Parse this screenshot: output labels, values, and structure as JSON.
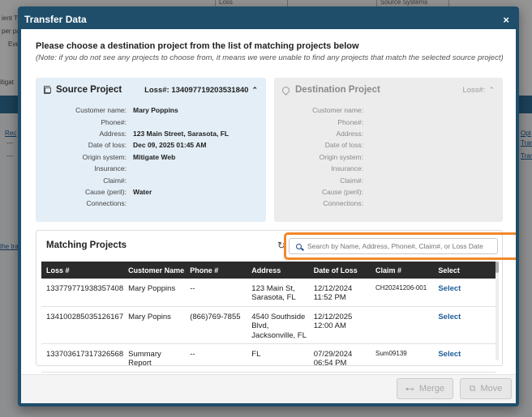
{
  "background": {
    "labels": [
      "ient Typ",
      "per pa",
      "Eve",
      "itigat",
      "Rec",
      "the trai",
      "Opt",
      "Tran",
      "Tran",
      "---",
      "---"
    ],
    "inputs": [
      "Loss",
      "Source Systems"
    ]
  },
  "modal": {
    "title": "Transfer Data",
    "close": "×",
    "heading": "Please choose a destination project from the list of matching projects below",
    "note": "(Note: if you do not see any projects to choose from, it means we were unable to find any projects that match the selected source project)"
  },
  "source": {
    "title": "Source Project",
    "loss": "Loss#: 134097719203531840",
    "chevron": "⌃",
    "fields": [
      {
        "label": "Customer name:",
        "value": "Mary Poppins"
      },
      {
        "label": "Phone#:",
        "value": ""
      },
      {
        "label": "Address:",
        "value": "123 Main Street, Sarasota, FL"
      },
      {
        "label": "Date of loss:",
        "value": "Dec 09, 2025 01:45 AM"
      },
      {
        "label": "Origin system:",
        "value": "Mitigate Web"
      },
      {
        "label": "Insurance:",
        "value": ""
      },
      {
        "label": "Claim#:",
        "value": ""
      },
      {
        "label": "Cause (peril):",
        "value": "Water"
      },
      {
        "label": "Connections:",
        "value": ""
      }
    ]
  },
  "destination": {
    "title": "Destination Project",
    "loss": "Loss#:",
    "chevron": "⌃",
    "fields": [
      {
        "label": "Customer name:"
      },
      {
        "label": "Phone#:"
      },
      {
        "label": "Address:"
      },
      {
        "label": "Date of loss:"
      },
      {
        "label": "Origin system:"
      },
      {
        "label": "Insurance:"
      },
      {
        "label": "Claim#:"
      },
      {
        "label": "Cause (peril):"
      },
      {
        "label": "Connections:"
      }
    ]
  },
  "matching": {
    "title": "Matching Projects",
    "refresh_icon": "↻",
    "search_placeholder": "Search by Name, Address, Phone#, Claim#, or Loss Date",
    "columns": [
      "Loss #",
      "Customer Name",
      "Phone #",
      "Address",
      "Date of Loss",
      "Claim #",
      "Select"
    ],
    "rows": [
      {
        "loss": "133779771938357408",
        "name": "Mary Poppins",
        "phone": "--",
        "address": "123 Main St, Sarasota, FL",
        "date": "12/12/2024 11:52 PM",
        "claim": "CH20241206-001",
        "select": "Select"
      },
      {
        "loss": "134100285035126167",
        "name": "Mary Popins",
        "phone": "(866)769-7855",
        "address": "4540 Southside Blvd, Jacksonville, FL",
        "date": "12/12/2025 12:00 AM",
        "claim": "",
        "select": "Select"
      },
      {
        "loss": "133703617317326568",
        "name": "Summary Report",
        "phone": "--",
        "address": "FL",
        "date": "07/29/2024 06:54 PM",
        "claim": "Sum09139",
        "select": "Select"
      }
    ]
  },
  "footer": {
    "merge_icon": "⊷",
    "merge_label": "Merge",
    "move_icon": "⧉",
    "move_label": "Move"
  },
  "colors": {
    "header": "#1f4e6b",
    "source_card": "#e3eef6",
    "highlight": "#f0882a",
    "link": "#1f5d9a"
  }
}
